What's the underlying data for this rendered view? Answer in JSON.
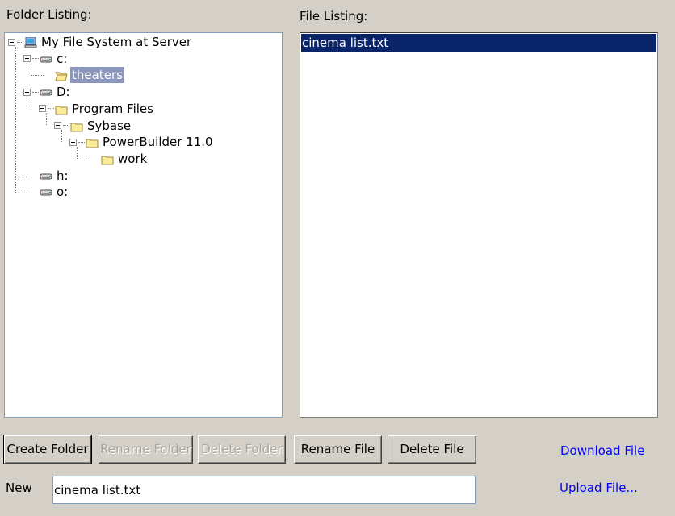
{
  "folder_panel": {
    "label": "Folder Listing:",
    "tree": [
      {
        "label": "My File System at Server",
        "icon": "computer-icon",
        "level": 0,
        "expanded": true,
        "selected": false
      },
      {
        "label": "c:",
        "icon": "drive-icon",
        "level": 1,
        "expanded": true,
        "selected": false
      },
      {
        "label": "theaters",
        "icon": "folder-open-icon",
        "level": 2,
        "expanded": false,
        "selected": true
      },
      {
        "label": "D:",
        "icon": "drive-icon",
        "level": 1,
        "expanded": true,
        "selected": false
      },
      {
        "label": "Program Files",
        "icon": "folder-icon",
        "level": 2,
        "expanded": true,
        "selected": false
      },
      {
        "label": "Sybase",
        "icon": "folder-icon",
        "level": 3,
        "expanded": true,
        "selected": false
      },
      {
        "label": "PowerBuilder 11.0",
        "icon": "folder-icon",
        "level": 4,
        "expanded": true,
        "selected": false
      },
      {
        "label": "work",
        "icon": "folder-icon",
        "level": 5,
        "expanded": false,
        "selected": false
      },
      {
        "label": "h:",
        "icon": "drive-icon",
        "level": 1,
        "expanded": false,
        "selected": false
      },
      {
        "label": "o:",
        "icon": "drive-icon",
        "level": 1,
        "expanded": false,
        "selected": false
      }
    ]
  },
  "file_panel": {
    "label": "File Listing:",
    "files": [
      {
        "name": "cinema list.txt",
        "selected": true
      }
    ]
  },
  "buttons": {
    "create_folder": "Create Folder",
    "rename_folder": "Rename Folder",
    "delete_folder": "Delete Folder",
    "rename_file": "Rename File",
    "delete_file": "Delete File"
  },
  "links": {
    "download": "Download File",
    "upload": "Upload File..."
  },
  "new_field": {
    "label": "New",
    "value": "cinema list.txt"
  },
  "colors": {
    "window_bg": "#d4d0c8",
    "selection_bg": "#0a246a",
    "tree_selection_bg": "#8a96bd",
    "link": "#0000ff",
    "disabled_text": "#a7a69f"
  }
}
